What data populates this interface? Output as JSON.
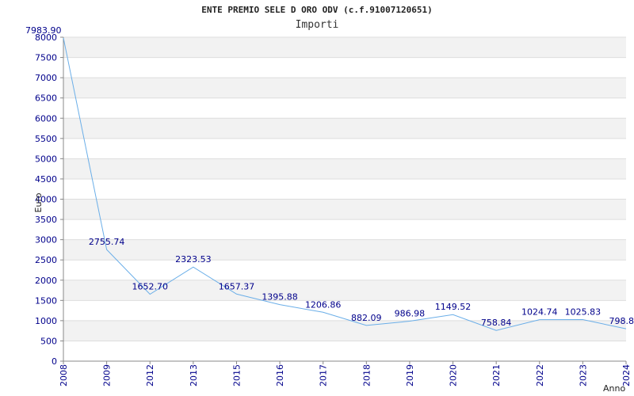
{
  "chart_data": {
    "type": "line",
    "title": "ENTE PREMIO SELE D ORO ODV (c.f.91007120651)",
    "subtitle": "Importi",
    "xlabel": "Anno",
    "ylabel": "Euro",
    "categories": [
      "2008",
      "2009",
      "2012",
      "2013",
      "2015",
      "2016",
      "2017",
      "2018",
      "2019",
      "2020",
      "2021",
      "2022",
      "2023",
      "2024"
    ],
    "values": [
      7983.9,
      2755.74,
      1652.7,
      2323.53,
      1657.37,
      1395.88,
      1206.86,
      882.09,
      986.98,
      1149.52,
      758.84,
      1024.74,
      1025.83,
      798.8
    ],
    "value_labels": [
      "7983.90",
      "2755.74",
      "1652.70",
      "2323.53",
      "1657.37",
      "1395.88",
      "1206.86",
      "882.09",
      "986.98",
      "1149.52",
      "758.84",
      "1024.74",
      "1025.83",
      "798.8"
    ],
    "ylim": [
      0,
      8000
    ],
    "yticks": [
      0,
      500,
      1000,
      1500,
      2000,
      2500,
      3000,
      3500,
      4000,
      4500,
      5000,
      5500,
      6000,
      6500,
      7000,
      7500,
      8000
    ],
    "grid": true,
    "line_color": "#6aaee8",
    "band_color": "#f2f2f2",
    "tick_color": "#00008b"
  }
}
